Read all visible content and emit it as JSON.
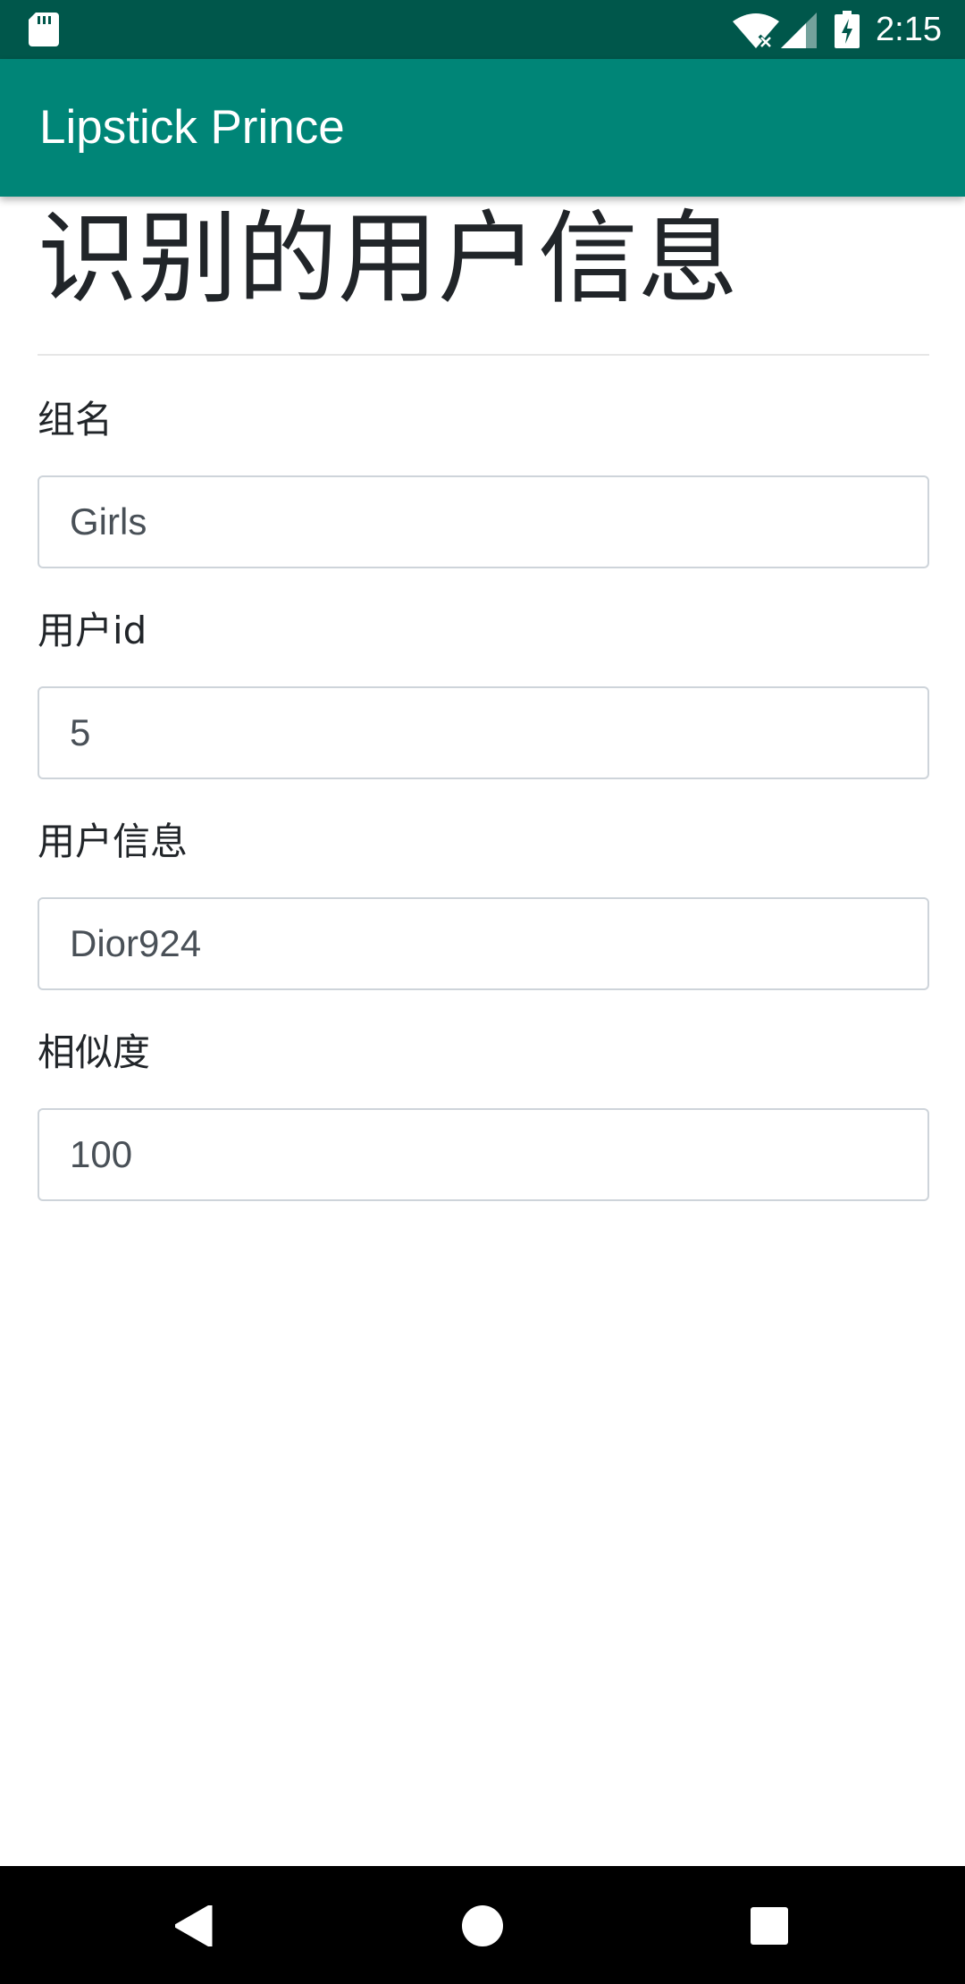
{
  "status_bar": {
    "time": "2:15",
    "icons": [
      "sd-card-icon",
      "wifi-icon",
      "signal-icon",
      "battery-charging-icon"
    ]
  },
  "app_bar": {
    "title": "Lipstick Prince",
    "color": "#008577",
    "status_color": "#00574b"
  },
  "page": {
    "title": "识别的用户信息"
  },
  "form": {
    "group_name": {
      "label": "组名",
      "value": "Girls"
    },
    "user_id": {
      "label": "用户id",
      "value": "5"
    },
    "user_info": {
      "label": "用户信息",
      "value": "Dior924"
    },
    "similarity": {
      "label": "相似度",
      "value": "100"
    }
  },
  "nav_bar": {
    "icons": [
      "back-icon",
      "home-icon",
      "recents-icon"
    ]
  }
}
